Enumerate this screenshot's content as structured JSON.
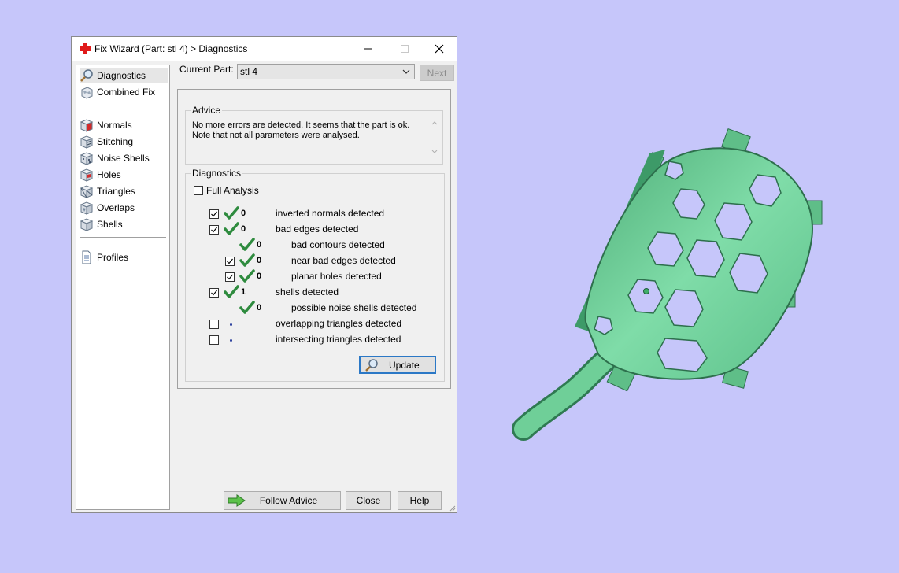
{
  "window": {
    "title": "Fix Wizard (Part: stl 4) > Diagnostics",
    "title_icon": "red-cross-icon"
  },
  "nav": {
    "items": [
      {
        "label": "Diagnostics",
        "icon": "magnifier-icon",
        "selected": true
      },
      {
        "label": "Combined Fix",
        "icon": "combined-fix-icon"
      },
      {
        "label": "Normals",
        "icon": "normals-cube-icon"
      },
      {
        "label": "Stitching",
        "icon": "stitching-cube-icon"
      },
      {
        "label": "Noise Shells",
        "icon": "noise-shells-cube-icon"
      },
      {
        "label": "Holes",
        "icon": "holes-cube-icon"
      },
      {
        "label": "Triangles",
        "icon": "triangles-cube-icon"
      },
      {
        "label": "Overlaps",
        "icon": "overlaps-cube-icon"
      },
      {
        "label": "Shells",
        "icon": "shells-cube-icon"
      },
      {
        "label": "Profiles",
        "icon": "document-icon"
      }
    ]
  },
  "current_part": {
    "label": "Current Part:",
    "value": "stl 4",
    "next_label": "Next"
  },
  "advice": {
    "title": "Advice",
    "line1": "No more errors are detected. It seems that the part is ok.",
    "line2": "Note that not all parameters were analysed."
  },
  "diagnostics": {
    "title": "Diagnostics",
    "full_analysis_label": "Full Analysis",
    "rows": [
      {
        "count": "0",
        "label": "inverted normals detected"
      },
      {
        "count": "0",
        "label": "bad edges detected"
      },
      {
        "count": "0",
        "label": "bad contours detected"
      },
      {
        "count": "0",
        "label": "near bad edges detected"
      },
      {
        "count": "0",
        "label": "planar holes detected"
      },
      {
        "count": "1",
        "label": "shells detected"
      },
      {
        "count": "0",
        "label": "possible noise shells detected"
      },
      {
        "label": "overlapping triangles detected"
      },
      {
        "label": "intersecting triangles detected"
      }
    ],
    "update_label": "Update"
  },
  "footer": {
    "follow_advice_label": "Follow Advice",
    "close_label": "Close",
    "help_label": "Help"
  },
  "colors": {
    "background": "#c6c6fa",
    "part_green": "#6fd49a",
    "check_green": "#2e8b3e",
    "accent_blue": "#2b78c6"
  }
}
